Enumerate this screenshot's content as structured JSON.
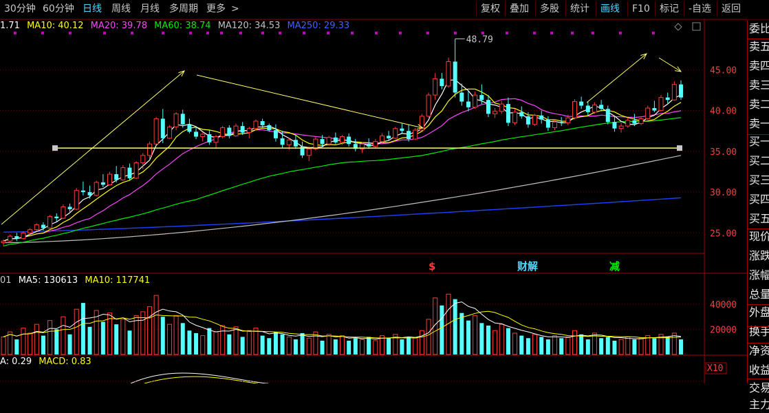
{
  "toolbar": {
    "left": [
      {
        "label": "30分钟",
        "active": false
      },
      {
        "label": "60分钟",
        "active": false
      },
      {
        "label": "日线",
        "active": true
      },
      {
        "label": "周线",
        "active": false
      },
      {
        "label": "月线",
        "active": false
      },
      {
        "label": "多周期",
        "active": false
      },
      {
        "label": "更多",
        "active": false
      }
    ],
    "more_arrow": ">",
    "right": [
      {
        "label": "复权",
        "active": false
      },
      {
        "label": "叠加",
        "active": false
      },
      {
        "label": "多股",
        "active": false
      },
      {
        "label": "统计",
        "active": false
      },
      {
        "label": "画线",
        "active": true
      },
      {
        "label": "F10",
        "active": false
      },
      {
        "label": "标记",
        "active": false
      },
      {
        "label": "-自选",
        "active": false
      },
      {
        "label": "返回",
        "active": false
      }
    ]
  },
  "price_legend": {
    "ma5": "1.71",
    "ma10": "MA10: 40.12",
    "ma20": "MA20: 39.78",
    "ma60": "MA60: 38.74",
    "ma120": "MA120: 34.53",
    "ma250": "MA250: 29.33"
  },
  "volume_legend": {
    "vol": "01",
    "ma5": "MA5: 130613",
    "ma10": "MA10: 117741"
  },
  "macd_legend": {
    "dea": "A: 0.29",
    "macd": "MACD: 0.83"
  },
  "price_axis": [
    "45.00",
    "40.00",
    "35.00",
    "30.00",
    "25.00"
  ],
  "volume_axis": [
    "40000",
    "20000",
    "X10"
  ],
  "high_label": "48.79",
  "event_markers": [
    "$",
    "财解",
    "减"
  ],
  "side_panel": [
    "委比",
    "卖五",
    "卖四",
    "卖三",
    "卖二",
    "卖一",
    "买一",
    "买二",
    "买三",
    "买四",
    "买五",
    "现价",
    "涨跌",
    "涨幅",
    "总量",
    "外盘",
    "换手",
    "净资",
    "收益",
    "交易",
    "主力"
  ],
  "colors": {
    "up": "#ff3b3b",
    "down": "#54ffff",
    "ma5": "#ffffff",
    "ma10": "#ffff00",
    "ma20": "#ff44ff",
    "ma60": "#00ee00",
    "ma120": "#c0c0c0",
    "ma250": "#2040ff",
    "grid": "#6a0000",
    "axis_text": "#ff3b3b",
    "accent": "#4fd7ff",
    "line_tool": "#ffff66",
    "dots": "#c000c0"
  },
  "chart_data": {
    "type": "candlestick",
    "note_units": "price CNY; volume shares",
    "ylim": [
      22.5,
      49.5
    ],
    "volume_ylim": [
      0,
      52000
    ],
    "candles": [
      [
        23.8,
        24.2,
        23.4,
        24.0
      ],
      [
        24.0,
        24.8,
        23.8,
        24.6
      ],
      [
        24.6,
        25.0,
        24.0,
        24.3
      ],
      [
        24.3,
        25.2,
        24.2,
        25.0
      ],
      [
        25.0,
        25.6,
        24.8,
        25.4
      ],
      [
        25.4,
        26.2,
        25.2,
        26.0
      ],
      [
        26.0,
        26.3,
        25.3,
        25.6
      ],
      [
        25.6,
        27.2,
        25.5,
        27.0
      ],
      [
        27.0,
        27.4,
        26.4,
        26.8
      ],
      [
        26.8,
        28.5,
        26.7,
        28.2
      ],
      [
        28.2,
        28.6,
        27.6,
        27.9
      ],
      [
        27.9,
        30.5,
        27.8,
        30.2
      ],
      [
        30.2,
        31.3,
        29.6,
        30.0
      ],
      [
        30.0,
        30.8,
        29.2,
        29.6
      ],
      [
        29.6,
        31.4,
        29.5,
        31.2
      ],
      [
        31.2,
        32.2,
        30.6,
        30.9
      ],
      [
        30.9,
        32.5,
        30.8,
        32.2
      ],
      [
        32.2,
        33.2,
        31.2,
        31.5
      ],
      [
        31.5,
        33.3,
        31.4,
        33.0
      ],
      [
        33.0,
        33.5,
        31.5,
        31.7
      ],
      [
        31.7,
        33.8,
        31.6,
        33.6
      ],
      [
        33.6,
        34.8,
        32.8,
        34.5
      ],
      [
        34.5,
        36.2,
        34.0,
        35.9
      ],
      [
        35.9,
        39.2,
        35.8,
        39.0
      ],
      [
        39.0,
        40.2,
        36.0,
        36.6
      ],
      [
        36.6,
        38.2,
        36.5,
        38.0
      ],
      [
        38.0,
        39.8,
        37.6,
        39.6
      ],
      [
        39.6,
        40.1,
        37.9,
        38.3
      ],
      [
        38.3,
        39.0,
        37.2,
        37.4
      ],
      [
        37.4,
        38.1,
        36.5,
        36.8
      ],
      [
        36.8,
        37.3,
        36.2,
        37.1
      ],
      [
        37.1,
        37.6,
        35.8,
        36.1
      ],
      [
        36.1,
        37.0,
        35.3,
        36.8
      ],
      [
        36.8,
        38.1,
        36.6,
        37.9
      ],
      [
        37.9,
        38.2,
        36.6,
        36.9
      ],
      [
        36.9,
        38.4,
        36.8,
        38.1
      ],
      [
        38.1,
        38.6,
        37.0,
        37.3
      ],
      [
        37.3,
        38.0,
        36.6,
        37.8
      ],
      [
        37.8,
        38.9,
        37.6,
        38.7
      ],
      [
        38.7,
        39.0,
        37.9,
        38.2
      ],
      [
        38.2,
        38.4,
        37.4,
        37.6
      ],
      [
        37.6,
        38.3,
        36.2,
        36.6
      ],
      [
        36.6,
        37.5,
        35.4,
        35.8
      ],
      [
        35.8,
        36.6,
        35.2,
        36.4
      ],
      [
        36.4,
        37.0,
        35.3,
        35.6
      ],
      [
        35.6,
        36.2,
        34.2,
        34.5
      ],
      [
        34.5,
        35.6,
        33.8,
        35.3
      ],
      [
        35.3,
        36.8,
        35.1,
        36.5
      ],
      [
        36.5,
        37.0,
        35.6,
        35.9
      ],
      [
        35.9,
        36.9,
        35.7,
        36.7
      ],
      [
        36.7,
        37.3,
        35.9,
        36.1
      ],
      [
        36.1,
        37.0,
        35.8,
        36.8
      ],
      [
        36.8,
        37.2,
        35.6,
        35.9
      ],
      [
        35.9,
        36.5,
        35.0,
        35.3
      ],
      [
        35.3,
        36.1,
        34.8,
        35.9
      ],
      [
        35.9,
        36.6,
        35.3,
        35.6
      ],
      [
        35.6,
        36.5,
        35.4,
        36.2
      ],
      [
        36.2,
        37.2,
        35.9,
        36.9
      ],
      [
        36.9,
        37.5,
        36.3,
        36.6
      ],
      [
        36.6,
        38.0,
        36.5,
        37.8
      ],
      [
        37.8,
        38.4,
        37.2,
        37.5
      ],
      [
        37.5,
        38.3,
        36.2,
        36.5
      ],
      [
        36.5,
        37.9,
        36.4,
        37.6
      ],
      [
        37.6,
        39.6,
        37.5,
        39.3
      ],
      [
        39.3,
        42.2,
        39.1,
        41.9
      ],
      [
        41.9,
        44.6,
        41.3,
        43.9
      ],
      [
        43.9,
        44.6,
        42.6,
        43.0
      ],
      [
        43.0,
        46.5,
        42.8,
        46.0
      ],
      [
        46.0,
        48.79,
        41.6,
        42.2
      ],
      [
        42.2,
        43.3,
        40.6,
        41.1
      ],
      [
        41.1,
        42.4,
        39.9,
        40.4
      ],
      [
        40.4,
        42.3,
        40.2,
        41.9
      ],
      [
        41.9,
        43.2,
        40.8,
        41.3
      ],
      [
        41.3,
        41.9,
        39.2,
        39.6
      ],
      [
        39.6,
        40.3,
        39.1,
        39.9
      ],
      [
        39.9,
        41.2,
        39.6,
        40.8
      ],
      [
        40.8,
        41.6,
        38.1,
        38.5
      ],
      [
        38.5,
        40.2,
        38.2,
        39.8
      ],
      [
        39.8,
        40.5,
        39.0,
        39.3
      ],
      [
        39.3,
        39.8,
        37.9,
        38.3
      ],
      [
        38.3,
        39.6,
        38.1,
        39.4
      ],
      [
        39.4,
        40.0,
        38.4,
        38.9
      ],
      [
        38.9,
        39.3,
        37.5,
        37.9
      ],
      [
        37.9,
        38.9,
        37.6,
        38.6
      ],
      [
        38.6,
        39.2,
        38.1,
        38.5
      ],
      [
        38.5,
        39.5,
        38.2,
        39.1
      ],
      [
        39.1,
        41.4,
        38.9,
        41.1
      ],
      [
        41.1,
        41.7,
        40.2,
        40.6
      ],
      [
        40.6,
        41.1,
        39.4,
        39.8
      ],
      [
        39.8,
        41.0,
        39.6,
        40.7
      ],
      [
        40.7,
        41.3,
        39.9,
        40.2
      ],
      [
        40.2,
        40.6,
        38.3,
        38.6
      ],
      [
        38.6,
        39.4,
        37.4,
        37.8
      ],
      [
        37.8,
        38.5,
        37.3,
        38.1
      ],
      [
        38.1,
        39.1,
        37.9,
        38.8
      ],
      [
        38.8,
        39.6,
        38.1,
        38.4
      ],
      [
        38.4,
        39.2,
        38.2,
        39.0
      ],
      [
        39.0,
        40.6,
        38.8,
        40.3
      ],
      [
        40.3,
        41.2,
        39.8,
        40.0
      ],
      [
        40.0,
        41.9,
        39.9,
        41.6
      ],
      [
        41.6,
        42.2,
        40.9,
        41.3
      ],
      [
        41.3,
        43.6,
        41.2,
        43.2
      ],
      [
        43.2,
        43.7,
        41.3,
        41.6
      ]
    ],
    "volumes": [
      14000,
      18000,
      12000,
      21000,
      17000,
      24000,
      15000,
      27000,
      20000,
      30000,
      16000,
      36000,
      41000,
      22000,
      35000,
      26000,
      33000,
      24000,
      28000,
      19000,
      31000,
      34000,
      38000,
      47000,
      30000,
      24000,
      31000,
      25000,
      19000,
      17000,
      15000,
      21000,
      18000,
      23000,
      16000,
      22000,
      14000,
      19000,
      21000,
      15000,
      13000,
      18000,
      16000,
      14000,
      12000,
      17000,
      13000,
      18000,
      11000,
      16000,
      12000,
      15000,
      11000,
      13000,
      12000,
      14000,
      11000,
      15000,
      13000,
      16000,
      12000,
      14000,
      13000,
      19000,
      28000,
      45000,
      39000,
      48000,
      44000,
      33000,
      27000,
      31000,
      25000,
      23000,
      19000,
      24000,
      21000,
      17000,
      15000,
      13000,
      16000,
      14000,
      12000,
      15000,
      13000,
      14000,
      19000,
      16000,
      12000,
      17000,
      13000,
      14000,
      11000,
      12000,
      14000,
      12000,
      13000,
      15000,
      13000,
      16000,
      14000,
      17000,
      12000
    ],
    "ma_lines": {
      "ma20_start": 25.0,
      "ma60_start": 22.9,
      "ma120_start": 23.8,
      "ma250_start": 25.1,
      "ma120_end": 34.5,
      "ma250_end": 29.3,
      "ma60_end": 38.7
    },
    "horizontal_line_price": 35.4
  }
}
